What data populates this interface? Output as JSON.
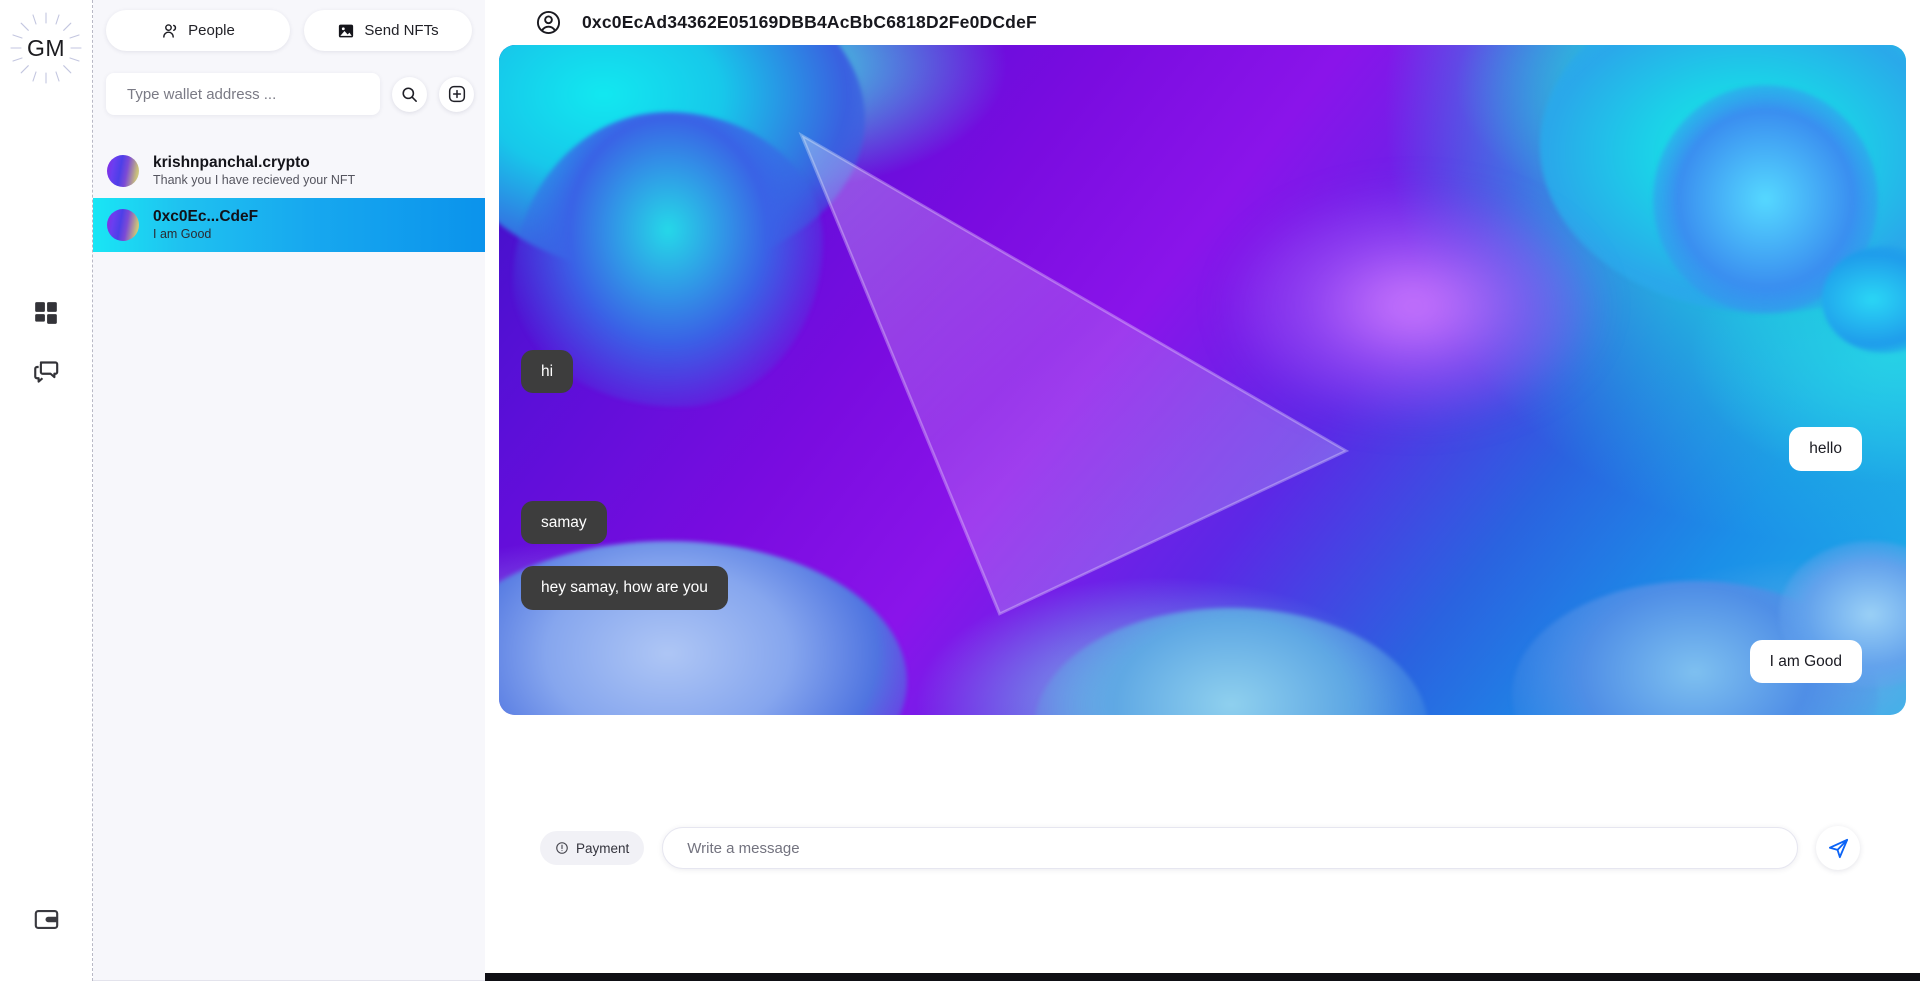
{
  "brand": {
    "logo_text": "GM",
    "logo_icon": "sun-rays-icon"
  },
  "rail": {
    "items": [
      {
        "icon": "dashboard-grid-icon",
        "name": "dashboard"
      },
      {
        "icon": "chat-bubbles-icon",
        "name": "messages"
      }
    ],
    "bottom_item": {
      "icon": "wallet-icon",
      "name": "wallet"
    }
  },
  "sidebar": {
    "tabs": [
      {
        "label": "People",
        "icon": "people-icon"
      },
      {
        "label": "Send NFTs",
        "icon": "image-icon"
      }
    ],
    "search": {
      "placeholder": "Type wallet address ...",
      "value": "",
      "search_icon": "search-icon",
      "add_icon": "add-circle-icon"
    },
    "conversations": [
      {
        "name": "krishnpanchal.crypto",
        "preview": "Thank you I have recieved your NFT",
        "selected": false
      },
      {
        "name": "0xc0Ec...CdeF",
        "preview": "I am Good",
        "selected": true
      }
    ]
  },
  "chat": {
    "header": {
      "address": "0xc0EcAd34362E05169DBB4AcBbC6818D2Fe0DCdeF",
      "avatar_icon": "user-circle-icon"
    },
    "messages": [
      {
        "text": "hi",
        "direction": "incoming"
      },
      {
        "text": "hello",
        "direction": "outgoing"
      },
      {
        "text": "samay",
        "direction": "incoming"
      },
      {
        "text": "hey samay, how are you",
        "direction": "incoming"
      },
      {
        "text": "I am Good",
        "direction": "outgoing"
      }
    ],
    "composer": {
      "payment_label": "Payment",
      "payment_icon": "info-circle-icon",
      "input_placeholder": "Write a message",
      "input_value": "",
      "send_icon": "send-icon"
    }
  },
  "colors": {
    "selected_conversation_start": "#19e6f5",
    "selected_conversation_end": "#0b93ec",
    "incoming_bubble": "#3d3d3d",
    "outgoing_bubble": "#ffffff",
    "sidebar_bg": "#f7f7fb",
    "text_primary": "#14141a"
  }
}
